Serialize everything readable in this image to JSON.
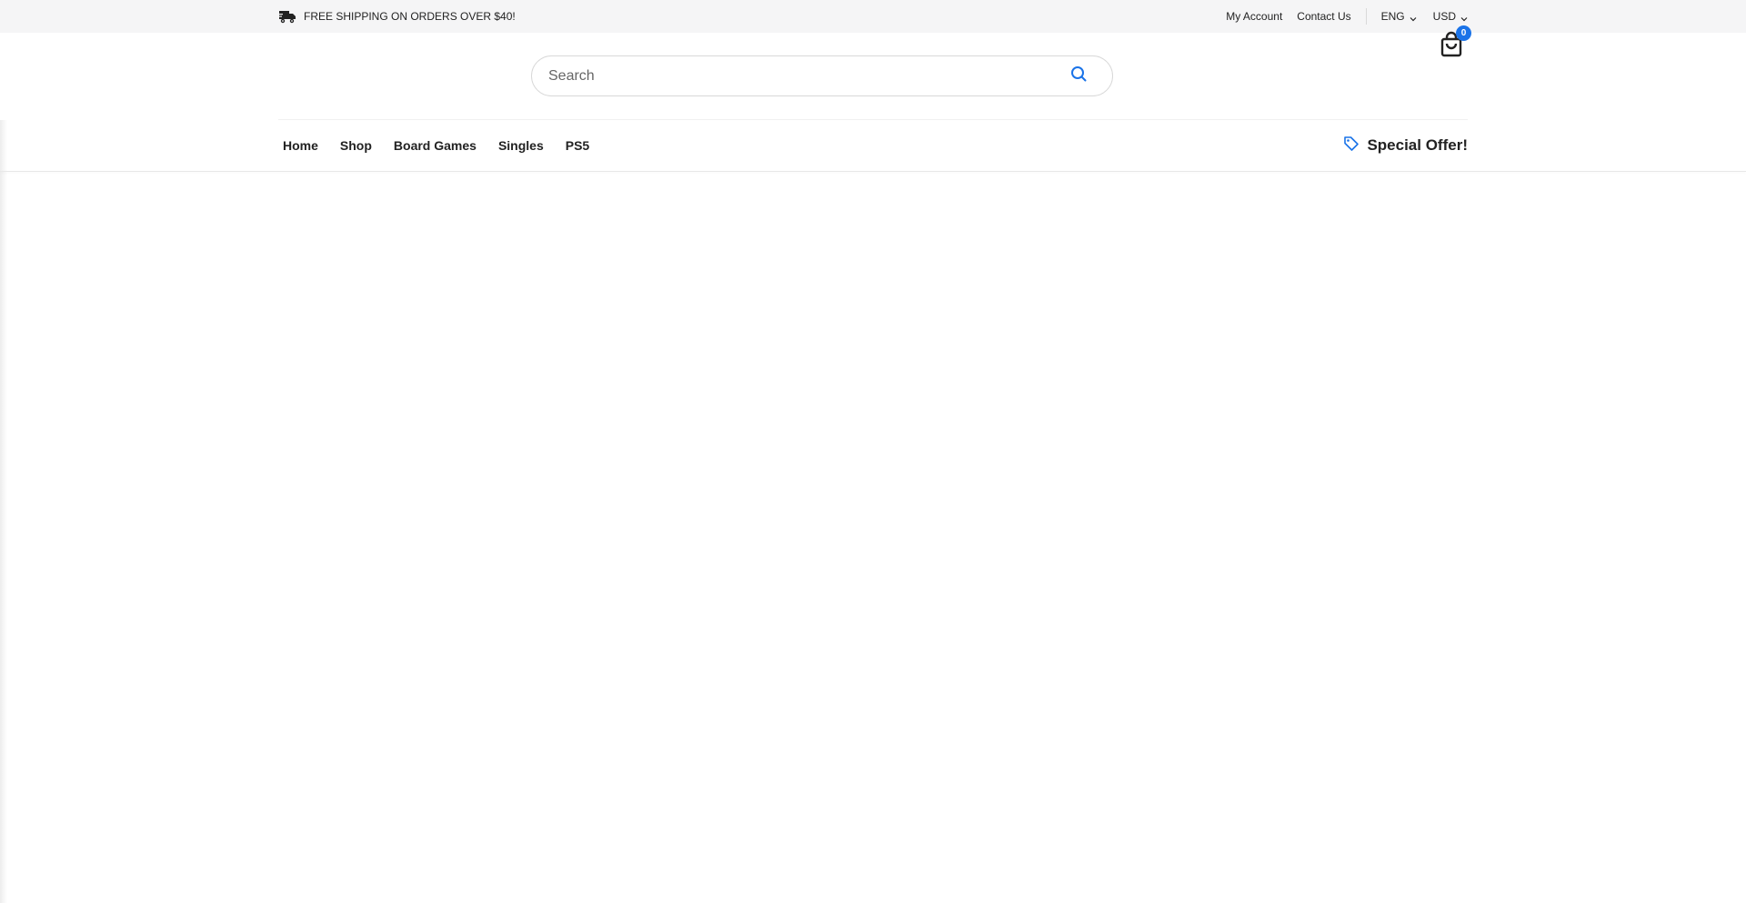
{
  "topbar": {
    "promo_text": "FREE SHIPPING ON ORDERS OVER $40!",
    "promo_icon": "truck-icon",
    "links": {
      "account": "My Account",
      "contact": "Contact Us"
    },
    "language": "ENG",
    "currency": "USD"
  },
  "search": {
    "placeholder": "Search",
    "value": ""
  },
  "cart": {
    "count": "0",
    "badge_color": "#1a73e8"
  },
  "nav": {
    "items": [
      {
        "label": "Home"
      },
      {
        "label": "Shop"
      },
      {
        "label": "Board Games"
      },
      {
        "label": "Singles"
      },
      {
        "label": "PS5"
      }
    ],
    "special_offer": "Special Offer!",
    "special_icon": "tag-icon",
    "accent_color": "#1a73e8"
  }
}
